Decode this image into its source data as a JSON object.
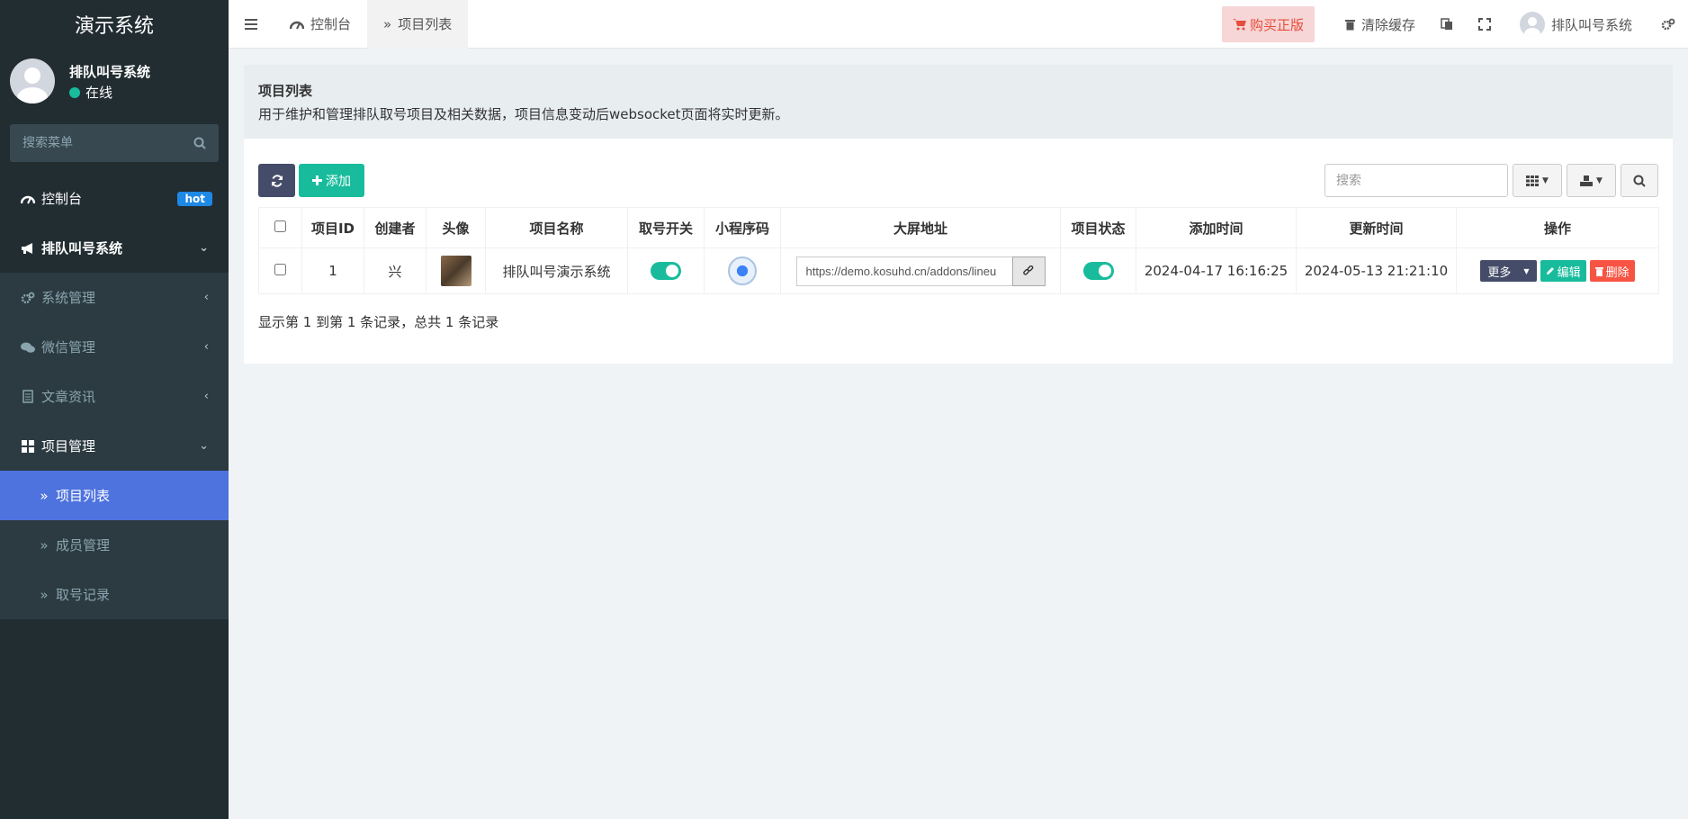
{
  "app": {
    "title": "演示系统"
  },
  "user": {
    "name": "排队叫号系统",
    "status": "在线"
  },
  "sidebar": {
    "search_placeholder": "搜索菜单",
    "items": [
      {
        "label": "控制台",
        "badge": "hot"
      },
      {
        "label": "排队叫号系统"
      },
      {
        "label": "系统管理"
      },
      {
        "label": "微信管理"
      },
      {
        "label": "文章资讯"
      },
      {
        "label": "项目管理"
      },
      {
        "label": "项目列表"
      },
      {
        "label": "成员管理"
      },
      {
        "label": "取号记录"
      }
    ]
  },
  "topbar": {
    "tabs": [
      {
        "label": "控制台"
      },
      {
        "label": "项目列表"
      }
    ],
    "buy_label": "购买正版",
    "clear_cache_label": "清除缓存",
    "user_label": "排队叫号系统"
  },
  "panel": {
    "title": "项目列表",
    "description": "用于维护和管理排队取号项目及相关数据，项目信息变动后websocket页面将实时更新。"
  },
  "toolbar": {
    "add_label": "添加",
    "search_placeholder": "搜索"
  },
  "table": {
    "headers": [
      "项目ID",
      "创建者",
      "头像",
      "项目名称",
      "取号开关",
      "小程序码",
      "大屏地址",
      "项目状态",
      "添加时间",
      "更新时间",
      "操作"
    ],
    "rows": [
      {
        "id": "1",
        "creator": "兴",
        "name": "排队叫号演示系统",
        "url": "https://demo.kosuhd.cn/addons/lineu",
        "add_time": "2024-04-17 16:16:25",
        "update_time": "2024-05-13 21:21:10",
        "switch_on": true,
        "status_on": true
      }
    ],
    "actions": {
      "more": "更多",
      "edit": "编辑",
      "delete": "删除"
    }
  },
  "pager": {
    "text": "显示第 1 到第 1 条记录，总共 1 条记录"
  },
  "colors": {
    "sidebar": "#222d32",
    "accent": "#18bc9c",
    "active": "#4e73df",
    "danger": "#f75444",
    "primary_dark": "#444c69"
  }
}
